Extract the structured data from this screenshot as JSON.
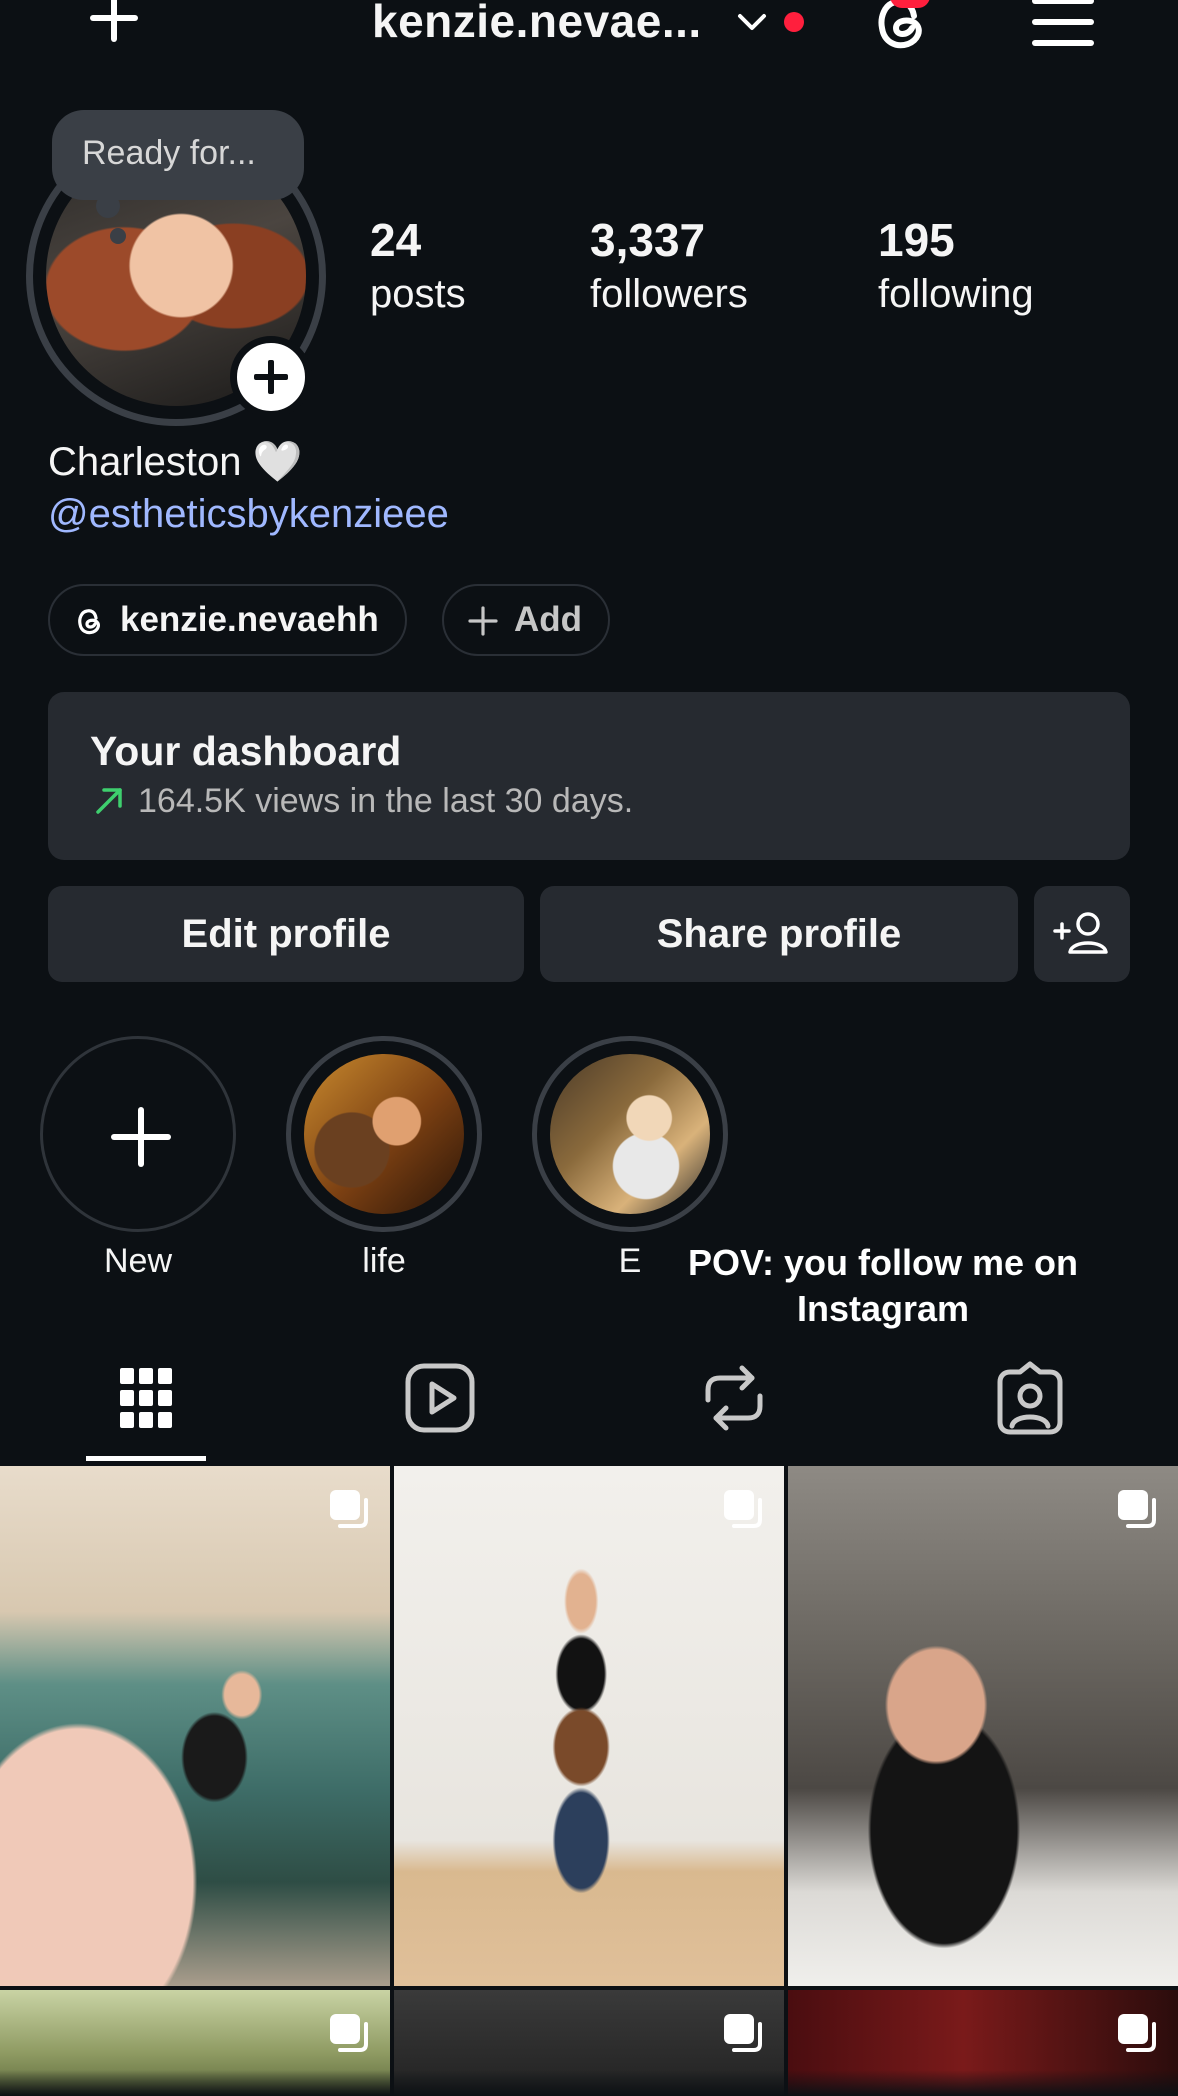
{
  "topbar": {
    "username": "kenzie.nevae...",
    "has_notification_dot": true
  },
  "profile": {
    "note": "Ready for...",
    "stats": [
      {
        "value": "24",
        "label": "posts"
      },
      {
        "value": "3,337",
        "label": "followers"
      },
      {
        "value": "195",
        "label": "following"
      }
    ],
    "bio_name": "Charleston 🤍",
    "bio_link": "@estheticsbykenzieee",
    "threads_handle": "kenzie.nevaehh",
    "add_label": "Add"
  },
  "dashboard": {
    "title": "Your dashboard",
    "subtitle": "164.5K views in the last 30 days."
  },
  "actions": {
    "edit_profile": "Edit profile",
    "share_profile": "Share profile"
  },
  "highlights": [
    {
      "label": "New"
    },
    {
      "label": "life"
    },
    {
      "label": "E"
    }
  ],
  "caption": "POV: you follow me on Instagram",
  "tabs": [
    "posts-grid",
    "reels",
    "reposts",
    "tagged"
  ],
  "colors": {
    "background": "#0c1014",
    "surface": "#262a30",
    "link": "#a0b8ff",
    "accent_red": "#ff1f3d",
    "trend_green": "#3ecf6e"
  }
}
